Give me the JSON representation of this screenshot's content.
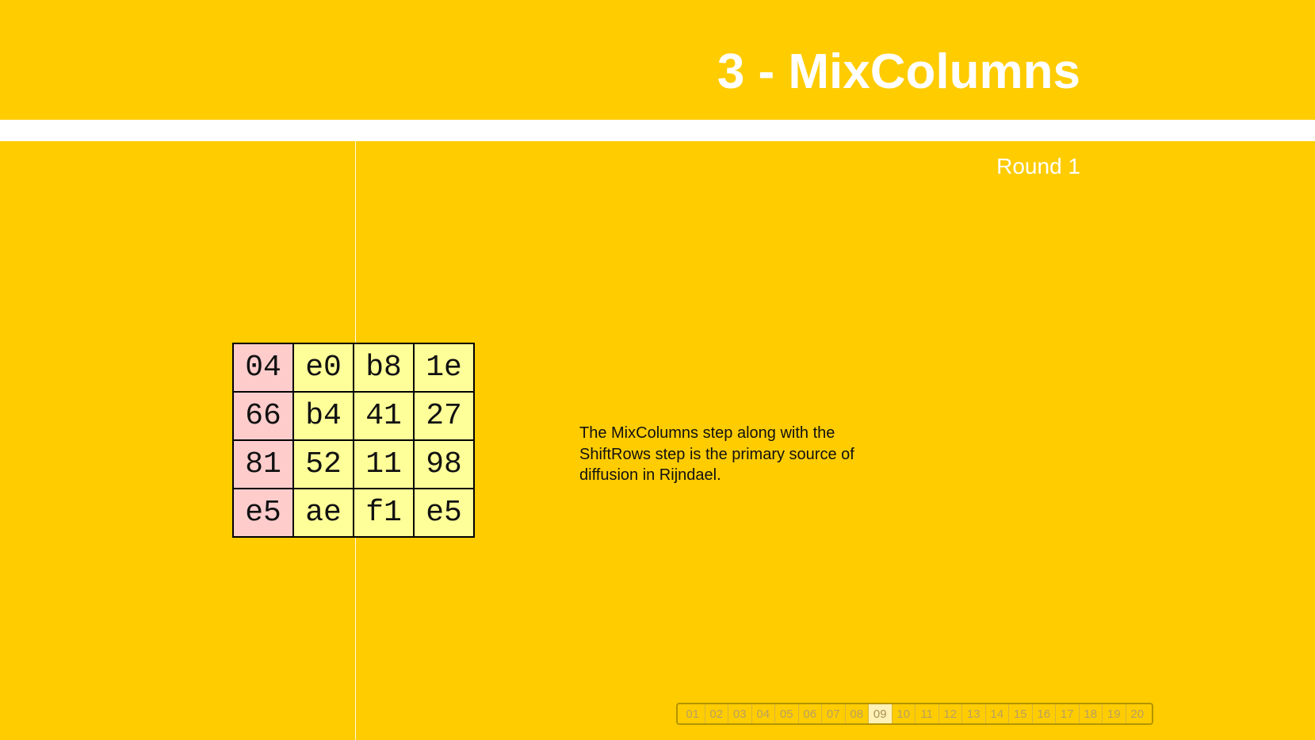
{
  "slide": {
    "title": "3 - MixColumns",
    "subtitle": "Round 1",
    "description": "The MixColumns step along with the ShiftRows step is the primary source of diffusion in Rijndael."
  },
  "state_matrix": [
    [
      "04",
      "e0",
      "b8",
      "1e"
    ],
    [
      "66",
      "b4",
      "41",
      "27"
    ],
    [
      "81",
      "52",
      "11",
      "98"
    ],
    [
      "e5",
      "ae",
      "f1",
      "e5"
    ]
  ],
  "colors": {
    "background": "#ffcc00",
    "band": "#ffffff",
    "highlight_column": "#ffcccc",
    "cell": "#ffff99"
  },
  "pager": {
    "items": [
      "01",
      "02",
      "03",
      "04",
      "05",
      "06",
      "07",
      "08",
      "09",
      "10",
      "11",
      "12",
      "13",
      "14",
      "15",
      "16",
      "17",
      "18",
      "19",
      "20"
    ],
    "active": "09"
  }
}
